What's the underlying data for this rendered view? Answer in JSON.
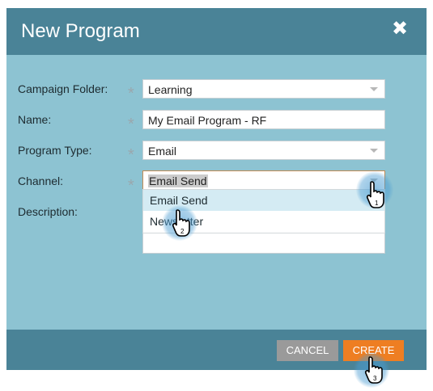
{
  "dialog": {
    "title": "New Program",
    "close_glyph": "✖"
  },
  "form": {
    "required_marker": "*",
    "campaign_folder": {
      "label": "Campaign Folder:",
      "value": "Learning"
    },
    "name": {
      "label": "Name:",
      "value": "My Email Program - RF"
    },
    "program_type": {
      "label": "Program Type:",
      "value": "Email"
    },
    "channel": {
      "label": "Channel:",
      "value": "Email Send",
      "options": [
        "Email Send",
        "Newsletter"
      ]
    },
    "description": {
      "label": "Description:",
      "value": ""
    }
  },
  "footer": {
    "cancel_label": "CANCEL",
    "create_label": "CREATE"
  },
  "steps": [
    "1",
    "2",
    "3"
  ],
  "colors": {
    "titlebar": "#4a8397",
    "body": "#8dc3d2",
    "create_button": "#ee7e22",
    "cancel_button": "#9a9a9a",
    "dropdown_hover": "#d4ebf3"
  }
}
